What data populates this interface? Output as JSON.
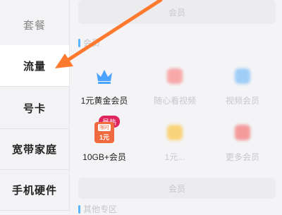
{
  "sidebar": {
    "items": [
      {
        "label": "套餐"
      },
      {
        "label": "流量"
      },
      {
        "label": "号卡"
      },
      {
        "label": "宽带家庭"
      },
      {
        "label": "手机硬件"
      }
    ]
  },
  "main": {
    "top_banner": "会员",
    "section1_title": "会员",
    "cards": [
      {
        "label": "1元黄金会员"
      },
      {
        "label": "随心看视频"
      },
      {
        "label": "视频会员"
      },
      {
        "label": "10GB+会员",
        "badge": "最热",
        "box_tag": "限时",
        "box_price": "1元"
      },
      {
        "label": "1元..."
      },
      {
        "label": "更多会员"
      }
    ],
    "bottom_banner": "会员",
    "section2_title": "其他专区"
  },
  "colors": {
    "accent_arrow": "#ff7a2e",
    "hot_badge": "#e0245e",
    "crown": "#4aa3ff",
    "box": "#ef6b3f"
  }
}
